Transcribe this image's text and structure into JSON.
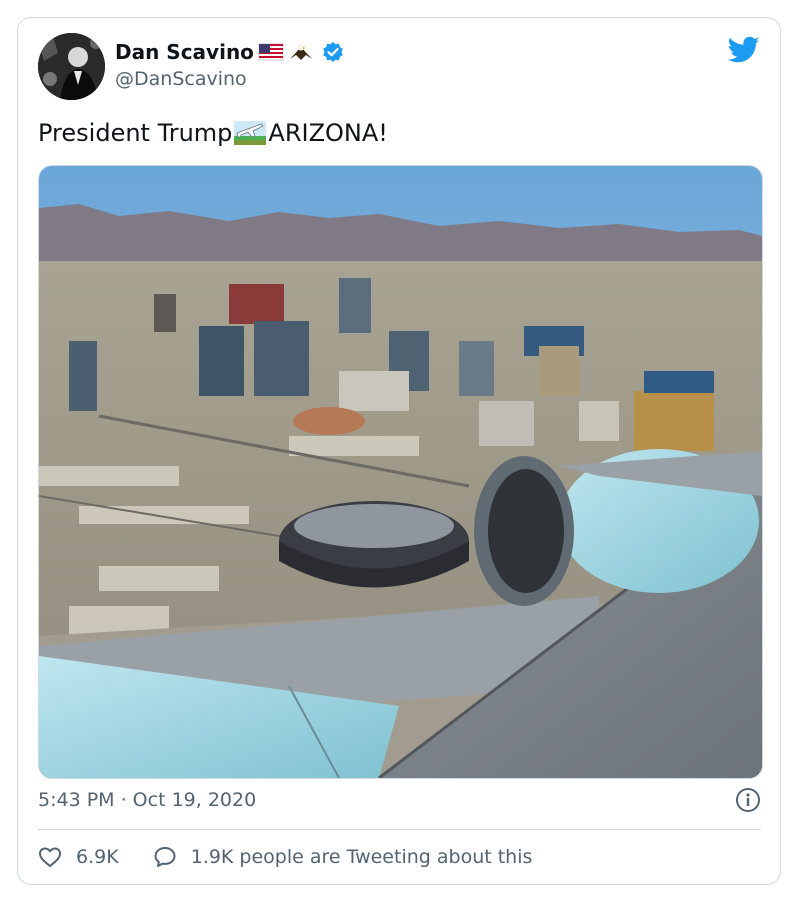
{
  "user": {
    "name": "Dan Scavino",
    "handle": "@DanScavino",
    "name_emojis": [
      "flag-us-icon",
      "eagle-icon"
    ],
    "verified": true
  },
  "tweet": {
    "text_before": "President Trump",
    "emoji": "airplane-emoji-icon",
    "text_after": "ARIZONA!",
    "photo_alt": "aerial-view-from-airplane-window-icon"
  },
  "meta": {
    "timestamp": "5:43 PM · Oct 19, 2020"
  },
  "actions": {
    "likes": "6.9K",
    "retweeting": "1.9K people are Tweeting about this"
  },
  "colors": {
    "text": "#0f1419",
    "muted": "#536471",
    "accent": "#1d9bf0",
    "border": "#cfd9de"
  }
}
